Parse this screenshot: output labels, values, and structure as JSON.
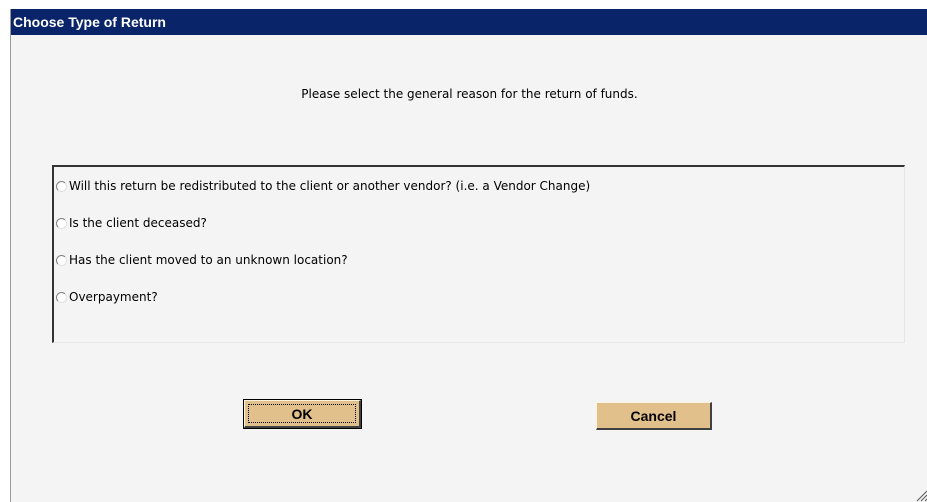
{
  "window": {
    "title": "Choose Type of Return"
  },
  "prompt": "Please select the general reason for the return of funds.",
  "options": [
    {
      "label": "Will this return be redistributed to the client or another vendor?  (i.e. a Vendor Change)",
      "selected": false
    },
    {
      "label": "Is the client deceased?",
      "selected": false
    },
    {
      "label": "Has the client moved to an unknown location?",
      "selected": false
    },
    {
      "label": "Overpayment?",
      "selected": false
    }
  ],
  "buttons": {
    "ok_label": "OK",
    "cancel_label": "Cancel"
  },
  "colors": {
    "titlebar": "#0a246a",
    "background": "#f4f4f4",
    "button": "#e2c08c"
  }
}
